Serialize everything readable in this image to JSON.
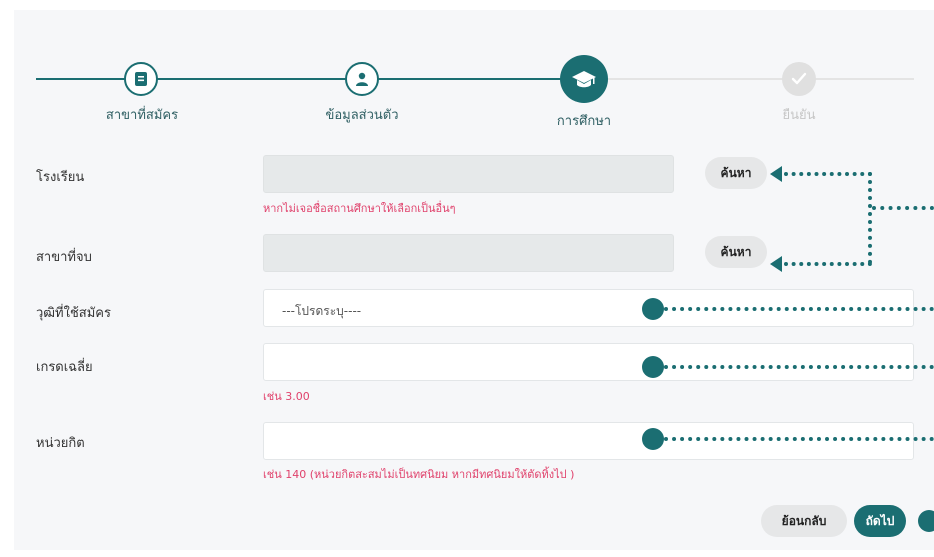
{
  "stepper": {
    "steps": [
      {
        "label": "สาขาที่สมัคร",
        "icon": "book-icon",
        "state": "done"
      },
      {
        "label": "ข้อมูลส่วนตัว",
        "icon": "person-icon",
        "state": "done"
      },
      {
        "label": "การศึกษา",
        "icon": "graduation-cap-icon",
        "state": "active"
      },
      {
        "label": "ยืนยัน",
        "icon": "checkmark-icon",
        "state": "disabled"
      }
    ]
  },
  "form": {
    "school": {
      "label": "โรงเรียน",
      "value": "",
      "search_label": "ค้นหา",
      "hint": "หากไม่เจอชื่อสถานศึกษาให้เลือกเป็นอื่นๆ"
    },
    "major": {
      "label": "สาขาที่จบ",
      "value": "",
      "search_label": "ค้นหา"
    },
    "qualification": {
      "label": "วุฒิที่ใช้สมัคร",
      "selected": "---โปรดระบุ----"
    },
    "gpa": {
      "label": "เกรดเฉลี่ย",
      "value": "",
      "hint": "เช่น 3.00"
    },
    "credits": {
      "label": "หน่วยกิต",
      "value": "",
      "hint": "เช่น 140 (หน่วยกิตสะสมไม่เป็นทศนิยม หากมีทศนิยมให้ตัดทิ้งไป )"
    }
  },
  "actions": {
    "back_label": "ย้อนกลับ",
    "next_label": "ถัดไป"
  },
  "colors": {
    "accent": "#1b6e72",
    "hint": "#e0426c",
    "disabled": "#c6c6c6"
  }
}
